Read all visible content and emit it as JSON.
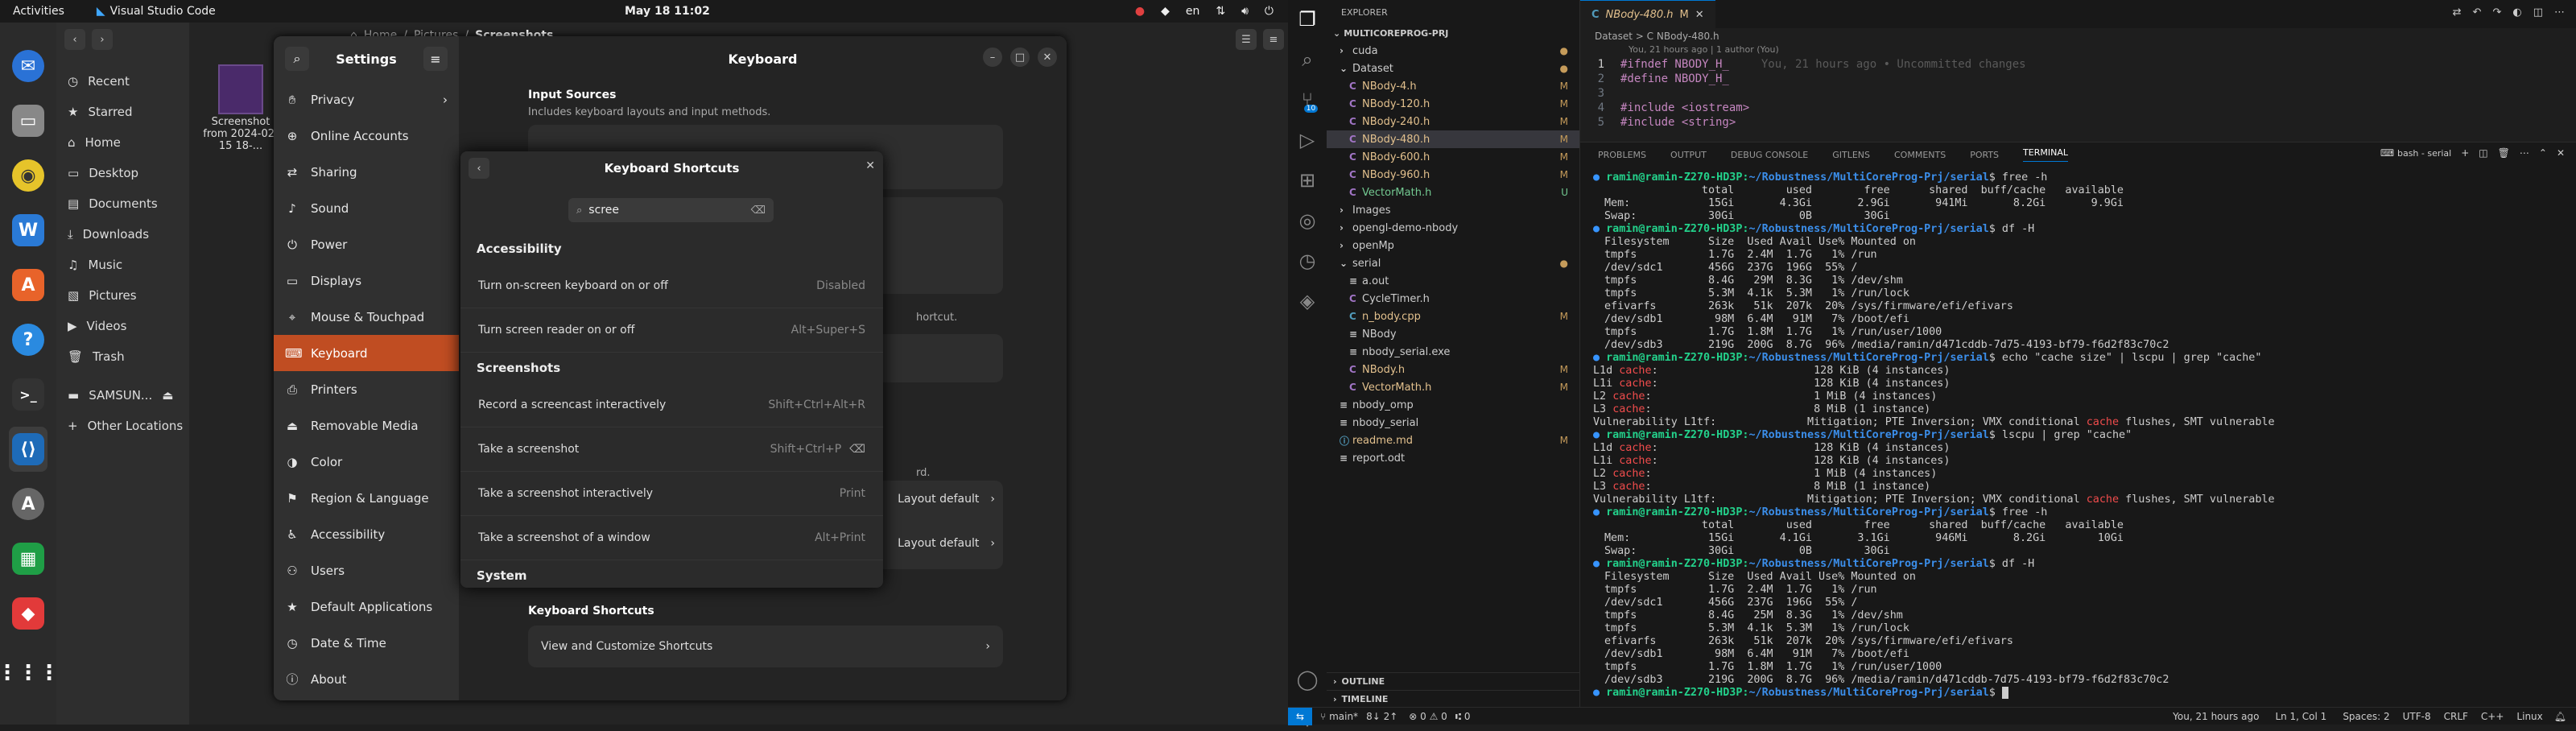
{
  "topbar": {
    "activities": "Activities",
    "app_name": "Visual Studio Code",
    "clock": "May 18  11:02",
    "lang": "en"
  },
  "dock": [
    "Thunderbird",
    "Files",
    "Rhythmbox",
    "Writer",
    "App Center",
    "Help",
    "Terminal",
    "VS Code",
    "Updater",
    "Calc",
    "AnyDesk",
    "Show Apps"
  ],
  "files": {
    "sidebar": [
      "Recent",
      "Starred",
      "Home",
      "Desktop",
      "Documents",
      "Downloads",
      "Music",
      "Pictures",
      "Videos",
      "Trash",
      "SAMSUN...",
      "Other Locations"
    ],
    "breadcrumb": [
      "Home",
      "Pictures",
      "Screenshots"
    ],
    "file_label": "Screenshot from 2024-02-15 18-..."
  },
  "settings": {
    "title": "Settings",
    "page_title": "Keyboard",
    "items": [
      "Privacy",
      "Online Accounts",
      "Sharing",
      "Sound",
      "Power",
      "Displays",
      "Mouse & Touchpad",
      "Keyboard",
      "Printers",
      "Removable Media",
      "Color",
      "Region & Language",
      "Accessibility",
      "Users",
      "Default Applications",
      "Date & Time",
      "About"
    ],
    "input_sources_title": "Input Sources",
    "input_sources_desc": "Includes keyboard layouts and input methods.",
    "shortcut_hint": "hortcut.",
    "layout_default": "Layout default",
    "kb_shortcuts_title": "Keyboard Shortcuts",
    "view_customize": "View and Customize Shortcuts",
    "rd": "rd."
  },
  "dialog": {
    "title": "Keyboard Shortcuts",
    "search_value": "scree",
    "sections": [
      {
        "name": "Accessibility",
        "rows": [
          {
            "label": "Turn on-screen keyboard on or off",
            "accel": "Disabled"
          },
          {
            "label": "Turn screen reader on or off",
            "accel": "Alt+Super+S"
          }
        ]
      },
      {
        "name": "Screenshots",
        "rows": [
          {
            "label": "Record a screencast interactively",
            "accel": "Shift+Ctrl+Alt+R"
          },
          {
            "label": "Take a screenshot",
            "accel": "Shift+Ctrl+P"
          },
          {
            "label": "Take a screenshot interactively",
            "accel": "Print"
          },
          {
            "label": "Take a screenshot of a window",
            "accel": "Alt+Print"
          }
        ]
      },
      {
        "name": "System",
        "rows": []
      }
    ]
  },
  "vscode": {
    "explorer_title": "EXPLORER",
    "project": "MULTICOREPROG-PRJ",
    "tree": [
      {
        "label": "cuda",
        "indent": 1,
        "folder": true,
        "mark": "dot"
      },
      {
        "label": "Dataset",
        "indent": 1,
        "folder": true,
        "open": true,
        "mark": "dot"
      },
      {
        "label": "NBody-4.h",
        "indent": 2,
        "mark": "M"
      },
      {
        "label": "NBody-120.h",
        "indent": 2,
        "mark": "M"
      },
      {
        "label": "NBody-240.h",
        "indent": 2,
        "mark": "M"
      },
      {
        "label": "NBody-480.h",
        "indent": 2,
        "mark": "M",
        "sel": true
      },
      {
        "label": "NBody-600.h",
        "indent": 2,
        "mark": "M"
      },
      {
        "label": "NBody-960.h",
        "indent": 2,
        "mark": "M"
      },
      {
        "label": "VectorMath.h",
        "indent": 2,
        "mark": "U"
      },
      {
        "label": "Images",
        "indent": 1,
        "folder": true
      },
      {
        "label": "opengl-demo-nbody",
        "indent": 1,
        "folder": true
      },
      {
        "label": "openMp",
        "indent": 1,
        "folder": true
      },
      {
        "label": "serial",
        "indent": 1,
        "folder": true,
        "open": true,
        "mark": "dot"
      },
      {
        "label": "a.out",
        "indent": 2
      },
      {
        "label": "CycleTimer.h",
        "indent": 2
      },
      {
        "label": "n_body.cpp",
        "indent": 2,
        "mark": "M"
      },
      {
        "label": "NBody",
        "indent": 2
      },
      {
        "label": "nbody_serial.exe",
        "indent": 2
      },
      {
        "label": "NBody.h",
        "indent": 2,
        "mark": "M"
      },
      {
        "label": "VectorMath.h",
        "indent": 2,
        "mark": "M"
      },
      {
        "label": "nbody_omp",
        "indent": 1
      },
      {
        "label": "nbody_serial",
        "indent": 1
      },
      {
        "label": "readme.md",
        "indent": 1,
        "mark": "M"
      },
      {
        "label": "report.odt",
        "indent": 1
      }
    ],
    "outline": "OUTLINE",
    "timeline": "TIMELINE",
    "tab": "NBody-480.h",
    "tab_mark": "M",
    "breadcrumb": "Dataset  >  C  NBody-480.h",
    "blame": "You, 21 hours ago | 1 author (You)",
    "code": [
      {
        "n": "1",
        "t": "#ifndef NBODY_H_",
        "ghost": "You, 21 hours ago • Uncommitted changes"
      },
      {
        "n": "2",
        "t": "#define NBODY_H_"
      },
      {
        "n": "3",
        "t": ""
      },
      {
        "n": "4",
        "t": "#include <iostream>"
      },
      {
        "n": "5",
        "t": "#include <string>"
      }
    ],
    "panel_tabs": [
      "PROBLEMS",
      "OUTPUT",
      "DEBUG CONSOLE",
      "GITLENS",
      "COMMENTS",
      "PORTS",
      "TERMINAL"
    ],
    "terminal_name": "bash - serial",
    "prompt": "ramin@ramin-Z270-HD3P:",
    "path": "~/Robustness/MultiCoreProg-Prj/serial",
    "terminal": [
      {
        "k": "p",
        "cmd": "free -h"
      },
      {
        "k": "o",
        "t": "               total        used        free      shared  buff/cache   available"
      },
      {
        "k": "o",
        "t": "Mem:            15Gi       4.3Gi       2.9Gi       941Mi       8.2Gi       9.9Gi"
      },
      {
        "k": "o",
        "t": "Swap:           30Gi          0B        30Gi"
      },
      {
        "k": "p",
        "cmd": "df -H"
      },
      {
        "k": "o",
        "t": "Filesystem      Size  Used Avail Use% Mounted on"
      },
      {
        "k": "o",
        "t": "tmpfs           1.7G  2.4M  1.7G   1% /run"
      },
      {
        "k": "o",
        "t": "/dev/sdc1       456G  237G  196G  55% /"
      },
      {
        "k": "o",
        "t": "tmpfs           8.4G   29M  8.3G   1% /dev/shm"
      },
      {
        "k": "o",
        "t": "tmpfs           5.3M  4.1k  5.3M   1% /run/lock"
      },
      {
        "k": "o",
        "t": "efivarfs        263k   51k  207k  20% /sys/firmware/efi/efivars"
      },
      {
        "k": "o",
        "t": "/dev/sdb1        98M  6.4M   91M   7% /boot/efi"
      },
      {
        "k": "o",
        "t": "tmpfs           1.7G  1.8M  1.7G   1% /run/user/1000"
      },
      {
        "k": "o",
        "t": "/dev/sdb3       219G  200G  8.7G  96% /media/ramin/d471cddb-7d75-4193-bf79-f6d2f83c70c2"
      },
      {
        "k": "p",
        "cmd": "echo \"cache size\" | lscpu | grep \"cache\""
      },
      {
        "k": "c",
        "a": "L1d ",
        "b": "cache",
        "c": ":                        128 KiB (4 instances)"
      },
      {
        "k": "c",
        "a": "L1i ",
        "b": "cache",
        "c": ":                        128 KiB (4 instances)"
      },
      {
        "k": "c",
        "a": "L2 ",
        "b": "cache",
        "c": ":                         1 MiB (4 instances)"
      },
      {
        "k": "c",
        "a": "L3 ",
        "b": "cache",
        "c": ":                         8 MiB (1 instance)"
      },
      {
        "k": "c",
        "a": "Vulnerability L1tf:              Mitigation; PTE Inversion; VMX conditional ",
        "b": "cache",
        "c": " flushes, SMT vulnerable"
      },
      {
        "k": "p",
        "cmd": "lscpu | grep \"cache\""
      },
      {
        "k": "c",
        "a": "L1d ",
        "b": "cache",
        "c": ":                        128 KiB (4 instances)"
      },
      {
        "k": "c",
        "a": "L1i ",
        "b": "cache",
        "c": ":                        128 KiB (4 instances)"
      },
      {
        "k": "c",
        "a": "L2 ",
        "b": "cache",
        "c": ":                         1 MiB (4 instances)"
      },
      {
        "k": "c",
        "a": "L3 ",
        "b": "cache",
        "c": ":                         8 MiB (1 instance)"
      },
      {
        "k": "c",
        "a": "Vulnerability L1tf:              Mitigation; PTE Inversion; VMX conditional ",
        "b": "cache",
        "c": " flushes, SMT vulnerable"
      },
      {
        "k": "p",
        "cmd": "free -h"
      },
      {
        "k": "o",
        "t": "               total        used        free      shared  buff/cache   available"
      },
      {
        "k": "o",
        "t": "Mem:            15Gi       4.1Gi       3.1Gi       946Mi       8.2Gi        10Gi"
      },
      {
        "k": "o",
        "t": "Swap:           30Gi          0B        30Gi"
      },
      {
        "k": "p",
        "cmd": "df -H"
      },
      {
        "k": "o",
        "t": "Filesystem      Size  Used Avail Use% Mounted on"
      },
      {
        "k": "o",
        "t": "tmpfs           1.7G  2.4M  1.7G   1% /run"
      },
      {
        "k": "o",
        "t": "/dev/sdc1       456G  237G  196G  55% /"
      },
      {
        "k": "o",
        "t": "tmpfs           8.4G   25M  8.3G   1% /dev/shm"
      },
      {
        "k": "o",
        "t": "tmpfs           5.3M  4.1k  5.3M   1% /run/lock"
      },
      {
        "k": "o",
        "t": "efivarfs        263k   51k  207k  20% /sys/firmware/efi/efivars"
      },
      {
        "k": "o",
        "t": "/dev/sdb1        98M  6.4M   91M   7% /boot/efi"
      },
      {
        "k": "o",
        "t": "tmpfs           1.7G  1.8M  1.7G   1% /run/user/1000"
      },
      {
        "k": "o",
        "t": "/dev/sdb3       219G  200G  8.7G  96% /media/ramin/d471cddb-7d75-4193-bf79-f6d2f83c70c2"
      },
      {
        "k": "p",
        "cmd": ""
      }
    ],
    "status": {
      "branch": "main*",
      "sync": "8↓ 2↑",
      "errors": "0",
      "warnings": "0",
      "ports": "0",
      "blame": "You, 21 hours ago",
      "pos": "Ln 1, Col 1",
      "spaces": "Spaces: 2",
      "enc": "UTF-8",
      "eol": "CRLF",
      "lang": "C++",
      "platform": "Linux"
    }
  }
}
